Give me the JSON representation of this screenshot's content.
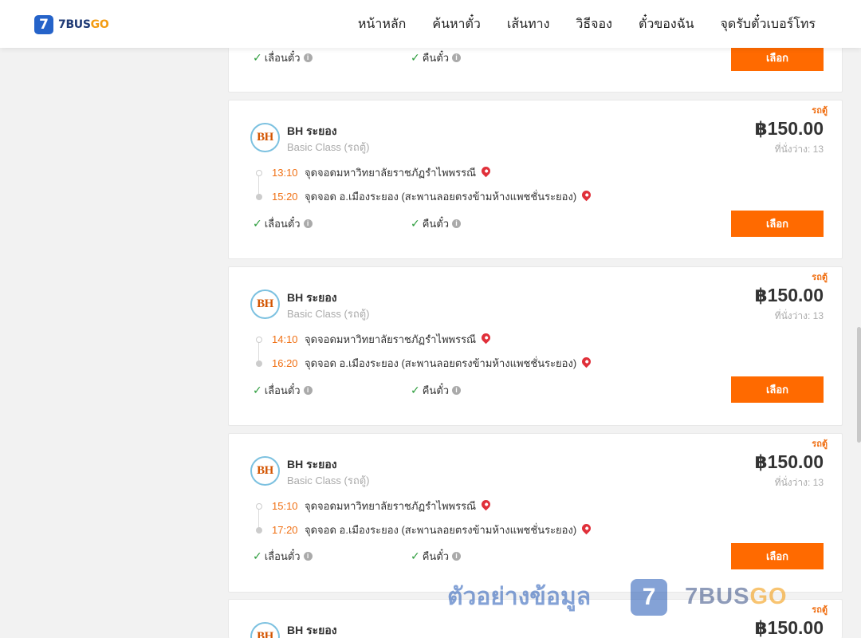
{
  "nav": {
    "logo_mark": "7",
    "logo_text": "7BUS",
    "logo_text_accent": "GO",
    "items": [
      {
        "label": "หน้าหลัก"
      },
      {
        "label": "ค้นหาตั๋ว"
      },
      {
        "label": "เส้นทาง"
      },
      {
        "label": "วิธีจอง"
      },
      {
        "label": "ตั๋วของฉัน"
      },
      {
        "label": "จุดรับตั๋วเบอร์โทร"
      }
    ]
  },
  "partial_card_top": {
    "reschedule": "เลื่อนตั๋ว",
    "refund": "คืนตั๋ว",
    "button": "เลือก"
  },
  "trips": [
    {
      "tag": "รถตู้",
      "operator_logo": "BH",
      "operator": "BH ระยอง",
      "class": "Basic Class (รถตู้)",
      "price": "฿150.00",
      "seats": "ที่นั่งว่าง: 13",
      "depart_time": "13:10",
      "depart_place": "จุดจอดมหาวิทยาลัยราชภัฏรำไพพรรณี",
      "arrive_time": "15:20",
      "arrive_place": "จุดจอด อ.เมืองระยอง (สะพานลอยตรงข้ามห้างแพชชั่นระยอง)",
      "reschedule": "เลื่อนตั๋ว",
      "refund": "คืนตั๋ว",
      "button": "เลือก"
    },
    {
      "tag": "รถตู้",
      "operator_logo": "BH",
      "operator": "BH ระยอง",
      "class": "Basic Class (รถตู้)",
      "price": "฿150.00",
      "seats": "ที่นั่งว่าง: 13",
      "depart_time": "14:10",
      "depart_place": "จุดจอดมหาวิทยาลัยราชภัฏรำไพพรรณี",
      "arrive_time": "16:20",
      "arrive_place": "จุดจอด อ.เมืองระยอง (สะพานลอยตรงข้ามห้างแพชชั่นระยอง)",
      "reschedule": "เลื่อนตั๋ว",
      "refund": "คืนตั๋ว",
      "button": "เลือก"
    },
    {
      "tag": "รถตู้",
      "operator_logo": "BH",
      "operator": "BH ระยอง",
      "class": "Basic Class (รถตู้)",
      "price": "฿150.00",
      "seats": "ที่นั่งว่าง: 13",
      "depart_time": "15:10",
      "depart_place": "จุดจอดมหาวิทยาลัยราชภัฏรำไพพรรณี",
      "arrive_time": "17:20",
      "arrive_place": "จุดจอด อ.เมืองระยอง (สะพานลอยตรงข้ามห้างแพชชั่นระยอง)",
      "reschedule": "เลื่อนตั๋ว",
      "refund": "คืนตั๋ว",
      "button": "เลือก"
    },
    {
      "tag": "รถตู้",
      "operator_logo": "BH",
      "operator": "BH ระยอง",
      "price": "฿150.00"
    }
  ],
  "watermark": {
    "text": "ตัวอย่างข้อมูล",
    "logo_mark": "7",
    "brand": "7BUS",
    "brand_accent": "GO"
  },
  "colors": {
    "accent": "#ff6a00",
    "time": "#f07014",
    "brand_blue": "#2563c9",
    "check": "#2e9d3e",
    "pin": "#e0303a"
  }
}
